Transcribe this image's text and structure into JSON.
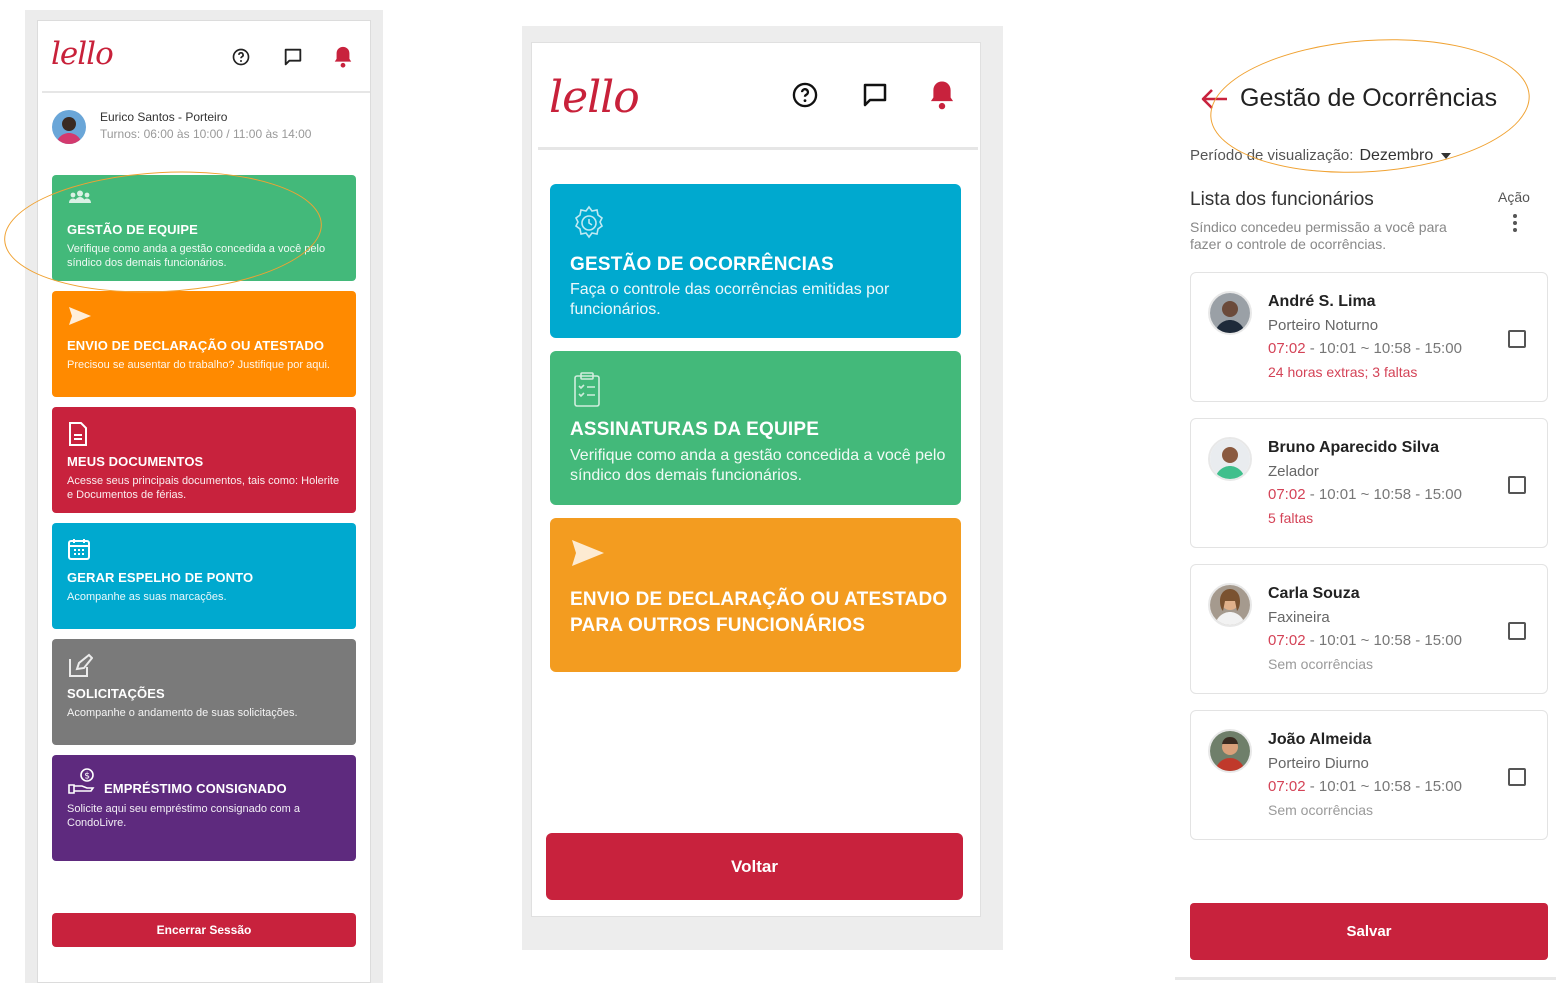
{
  "screen1": {
    "logo": "lello",
    "user": {
      "name": "Eurico Santos - Porteiro",
      "shift": "Turnos: 06:00 às 10:00 / 11:00 às 14:00"
    },
    "cards": [
      {
        "title": "GESTÃO DE EQUIPE",
        "desc": "Verifique como anda a gestão concedida a você pelo síndico dos demais funcionários.",
        "icon": "team-icon",
        "color": "#43b97a"
      },
      {
        "title": "ENVIO DE DECLARAÇÃO OU ATESTADO",
        "desc": "Precisou se ausentar do trabalho? Justifique por aqui.",
        "icon": "send-icon",
        "color": "#ff8a00"
      },
      {
        "title": "MEUS DOCUMENTOS",
        "desc": "Acesse seus principais documentos, tais como: Holerite e Documentos de férias.",
        "icon": "document-icon",
        "color": "#c8223d"
      },
      {
        "title": "GERAR ESPELHO DE PONTO",
        "desc": "Acompanhe as suas marcações.",
        "icon": "calendar-icon",
        "color": "#00a9cf"
      },
      {
        "title": "SOLICITAÇÕES",
        "desc": "Acompanhe o andamento de suas solicitações.",
        "icon": "edit-icon",
        "color": "#7a7a7a"
      },
      {
        "title": "EMPRÉSTIMO CONSIGNADO",
        "desc": "Solicite aqui seu empréstimo consignado com a CondoLivre.",
        "icon": "money-hand-icon",
        "color": "#5e2a7e"
      }
    ],
    "logout_label": "Encerrar Sessão"
  },
  "screen2": {
    "logo": "lello",
    "cards": [
      {
        "title": "GESTÃO DE OCORRÊNCIAS",
        "desc": "Faça o controle das ocorrências emitidas por funcionários.",
        "icon": "gear-clock-icon",
        "color": "#00a9cf"
      },
      {
        "title": "ASSINATURAS DA EQUIPE",
        "desc": "Verifique como anda a gestão concedida a você pelo síndico dos demais funcionários.",
        "icon": "clipboard-icon",
        "color": "#43b97a"
      },
      {
        "title": "ENVIO DE DECLARAÇÃO OU ATESTADO PARA OUTROS FUNCIONÁRIOS",
        "desc": "",
        "icon": "send-icon",
        "color": "#f39c20"
      }
    ],
    "back_label": "Voltar"
  },
  "screen3": {
    "title": "Gestão de Ocorrências",
    "period_label": "Período de visualização:",
    "period_value": "Dezembro",
    "list_title": "Lista dos funcionários",
    "list_desc": "Síndico concedeu permissão a você para fazer o controle de ocorrências.",
    "action_label": "Ação",
    "employees": [
      {
        "name": "André S. Lima",
        "role": "Porteiro Noturno",
        "late": "07:02",
        "hours": " - 10:01 ~ 10:58 - 15:00",
        "occurrences": "24 horas extras; 3 faltas",
        "has_occurrence": true
      },
      {
        "name": "Bruno Aparecido Silva",
        "role": "Zelador",
        "late": "07:02",
        "hours": " - 10:01 ~ 10:58 - 15:00",
        "occurrences": "5 faltas",
        "has_occurrence": true
      },
      {
        "name": "Carla Souza",
        "role": "Faxineira",
        "late": "07:02",
        "hours": " - 10:01 ~ 10:58 - 15:00",
        "occurrences": "Sem ocorrências",
        "has_occurrence": false
      },
      {
        "name": "João Almeida",
        "role": "Porteiro Diurno",
        "late": "07:02",
        "hours": " - 10:01 ~ 10:58 - 15:00",
        "occurrences": "Sem ocorrências",
        "has_occurrence": false
      }
    ],
    "save_label": "Salvar"
  },
  "colors": {
    "brand_red": "#c8223d",
    "highlight_ellipse": "#f0a232"
  }
}
